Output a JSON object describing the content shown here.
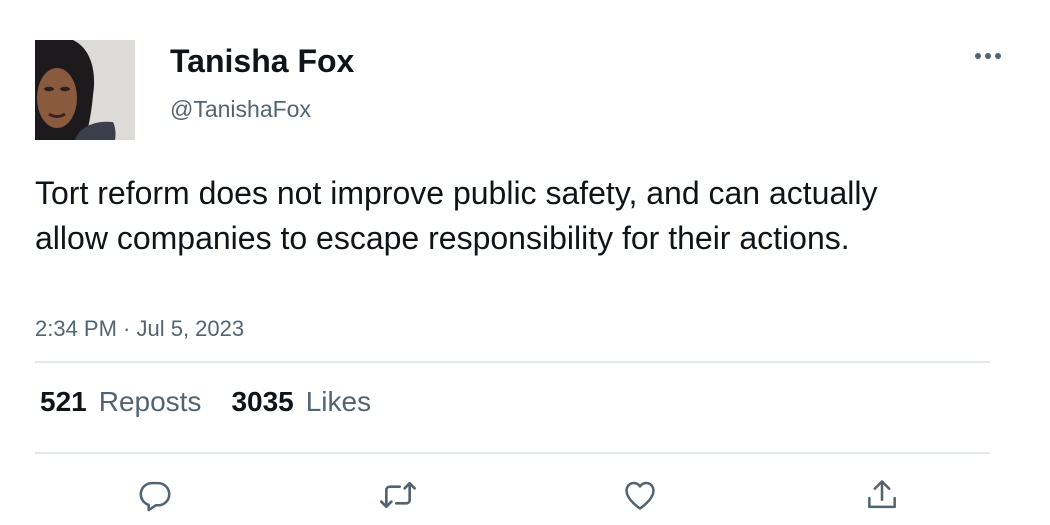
{
  "author": {
    "name": "Tanisha Fox",
    "handle": "@TanishaFox",
    "avatar_icon": "profile-photo"
  },
  "tweet": {
    "text": "Tort reform does not improve public safety, and can actually allow companies to escape responsibility for their actions.",
    "timestamp": "2:34 PM · Jul 5, 2023"
  },
  "stats": {
    "reposts_count": "521",
    "reposts_label": "Reposts",
    "likes_count": "3035",
    "likes_label": "Likes"
  },
  "actions": {
    "reply_icon": "speech-bubble-icon",
    "repost_icon": "repost-arrows-icon",
    "like_icon": "heart-icon",
    "share_icon": "share-upload-icon",
    "more_icon": "ellipsis-icon"
  },
  "colors": {
    "text_primary": "#0f1419",
    "text_secondary": "#536471",
    "divider": "#e4e8eb",
    "icon": "#536471"
  }
}
